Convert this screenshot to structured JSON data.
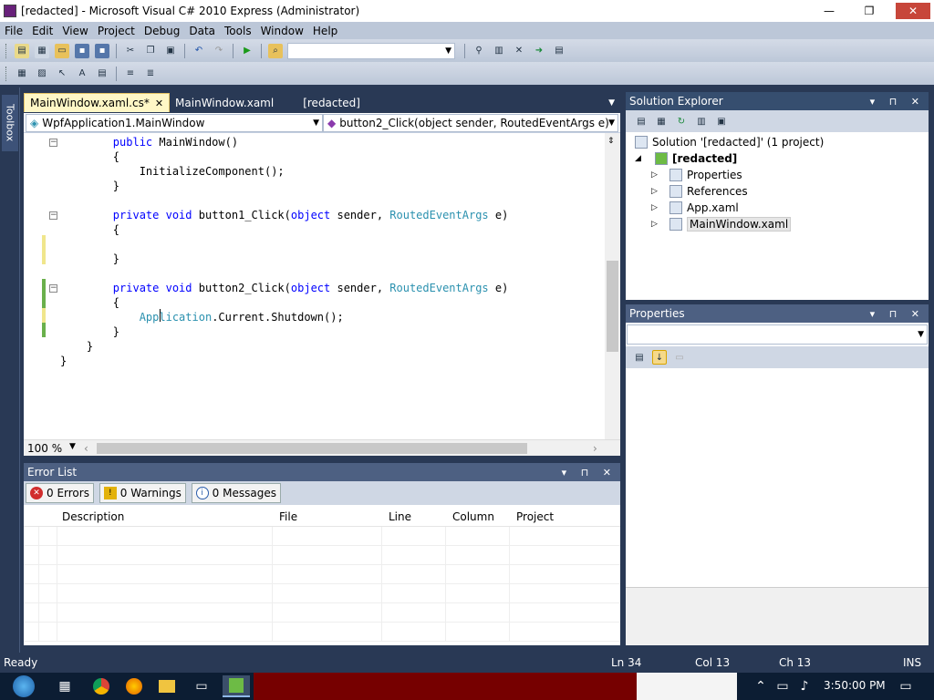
{
  "window": {
    "title": "[redacted] - Microsoft Visual C# 2010 Express (Administrator)",
    "minimize": "—",
    "restore": "❐",
    "close": "✕"
  },
  "menu": [
    "File",
    "Edit",
    "View",
    "Project",
    "Debug",
    "Data",
    "Tools",
    "Window",
    "Help"
  ],
  "toolbox": {
    "label": "Toolbox"
  },
  "tabs": [
    {
      "label": "MainWindow.xaml.cs*",
      "close": "✕"
    },
    {
      "label": "MainWindow.xaml"
    },
    {
      "label": "[redacted]"
    }
  ],
  "nav": {
    "type_combo": "WpfApplication1.MainWindow",
    "member_combo": "button2_Click(object sender, RoutedEventArgs e)"
  },
  "zoom": "100 %",
  "error_list": {
    "title": "Error List",
    "errors": "0 Errors",
    "warnings": "0 Warnings",
    "messages": "0 Messages",
    "columns": [
      "Description",
      "File",
      "Line",
      "Column",
      "Project"
    ]
  },
  "solution_explorer": {
    "title": "Solution Explorer",
    "solution": "Solution '[redacted]' (1 project)",
    "project": "[redacted]",
    "items": [
      "Properties",
      "References",
      "App.xaml",
      "MainWindow.xaml"
    ]
  },
  "properties": {
    "title": "Properties"
  },
  "status": {
    "ready": "Ready",
    "ln": "Ln 34",
    "col": "Col 13",
    "ch": "Ch 13",
    "ins": "INS"
  },
  "taskbar": {
    "time": "3:50:00 PM"
  }
}
